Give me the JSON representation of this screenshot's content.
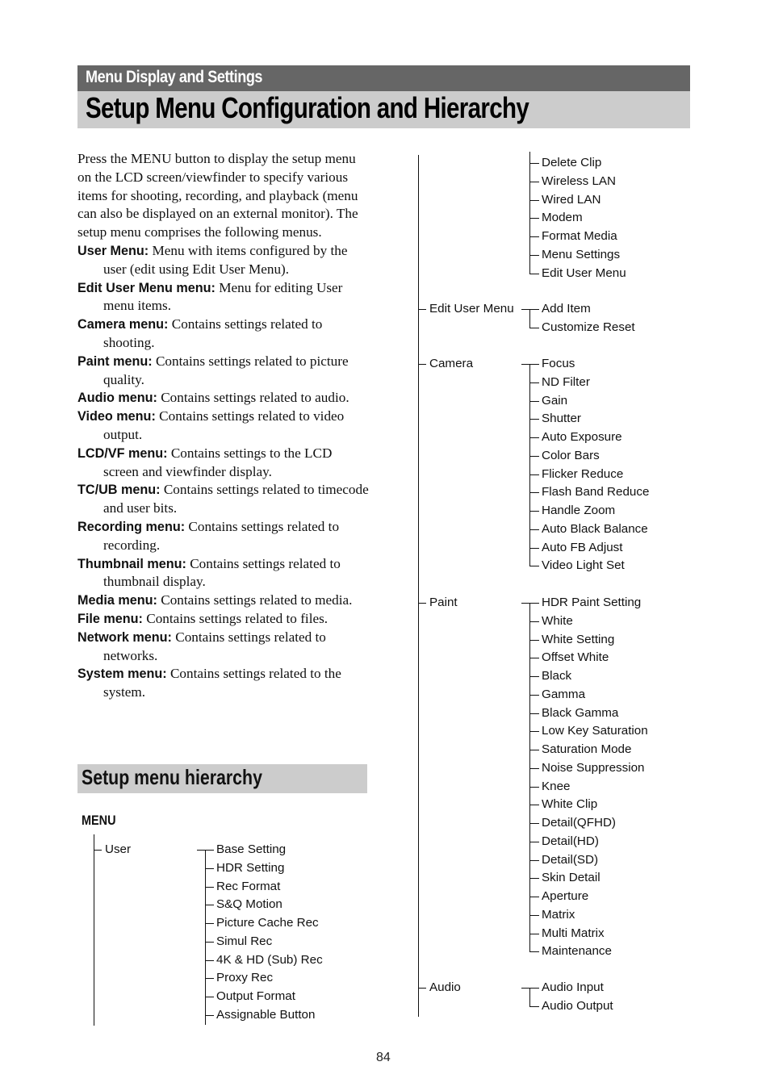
{
  "header": {
    "section": "Menu Display and Settings",
    "title": "Setup Menu Configuration and Hierarchy"
  },
  "intro": {
    "paragraph": "Press the MENU button to display the setup menu on the LCD screen/viewfinder to specify various items for shooting, recording, and playback (menu can also be displayed on an external monitor). The setup menu comprises the following menus.",
    "definitions": [
      {
        "term": "User Menu:",
        "desc": " Menu with items configured by the user (edit using Edit User Menu)."
      },
      {
        "term": "Edit User Menu menu:",
        "desc": " Menu for editing User menu items."
      },
      {
        "term": "Camera menu:",
        "desc": " Contains settings related to shooting."
      },
      {
        "term": "Paint menu:",
        "desc": " Contains settings related to picture quality."
      },
      {
        "term": "Audio menu:",
        "desc": " Contains settings related to audio."
      },
      {
        "term": "Video menu:",
        "desc": " Contains settings related to video output."
      },
      {
        "term": "LCD/VF menu:",
        "desc": " Contains settings to the LCD screen and viewfinder display."
      },
      {
        "term": "TC/UB menu:",
        "desc": " Contains settings related to timecode and user bits."
      },
      {
        "term": "Recording menu:",
        "desc": " Contains settings related to recording."
      },
      {
        "term": "Thumbnail menu:",
        "desc": " Contains settings related to thumbnail display."
      },
      {
        "term": "Media menu:",
        "desc": " Contains settings related to media."
      },
      {
        "term": "File menu:",
        "desc": " Contains settings related to files."
      },
      {
        "term": "Network menu:",
        "desc": " Contains settings related to networks."
      },
      {
        "term": "System menu:",
        "desc": " Contains settings related to the system."
      }
    ]
  },
  "hierarchy": {
    "heading": "Setup menu hierarchy",
    "root": "MENU",
    "groups": [
      {
        "label": "User",
        "items": [
          "Base Setting",
          "HDR Setting",
          "Rec Format",
          "S&Q Motion",
          "Picture Cache Rec",
          "Simul Rec",
          "4K & HD (Sub) Rec",
          "Proxy Rec",
          "Output Format",
          "Assignable Button"
        ],
        "continued_items": [
          "Delete Clip",
          "Wireless LAN",
          "Wired LAN",
          "Modem",
          "Format Media",
          "Menu Settings",
          "Edit User Menu"
        ]
      },
      {
        "label": "Edit User Menu",
        "items": [
          "Add Item",
          "Customize Reset"
        ]
      },
      {
        "label": "Camera",
        "items": [
          "Focus",
          "ND Filter",
          "Gain",
          "Shutter",
          "Auto Exposure",
          "Color Bars",
          "Flicker Reduce",
          "Flash Band Reduce",
          "Handle Zoom",
          "Auto Black Balance",
          "Auto FB Adjust",
          "Video Light Set"
        ]
      },
      {
        "label": "Paint",
        "items": [
          "HDR Paint Setting",
          "White",
          "White Setting",
          "Offset White",
          "Black",
          "Gamma",
          "Black Gamma",
          "Low Key Saturation",
          "Saturation Mode",
          "Noise Suppression",
          "Knee",
          "White Clip",
          "Detail(QFHD)",
          "Detail(HD)",
          "Detail(SD)",
          "Skin Detail",
          "Aperture",
          "Matrix",
          "Multi Matrix",
          "Maintenance"
        ]
      },
      {
        "label": "Audio",
        "items": [
          "Audio Input",
          "Audio Output"
        ]
      }
    ]
  },
  "footer": {
    "page_number": "84"
  }
}
